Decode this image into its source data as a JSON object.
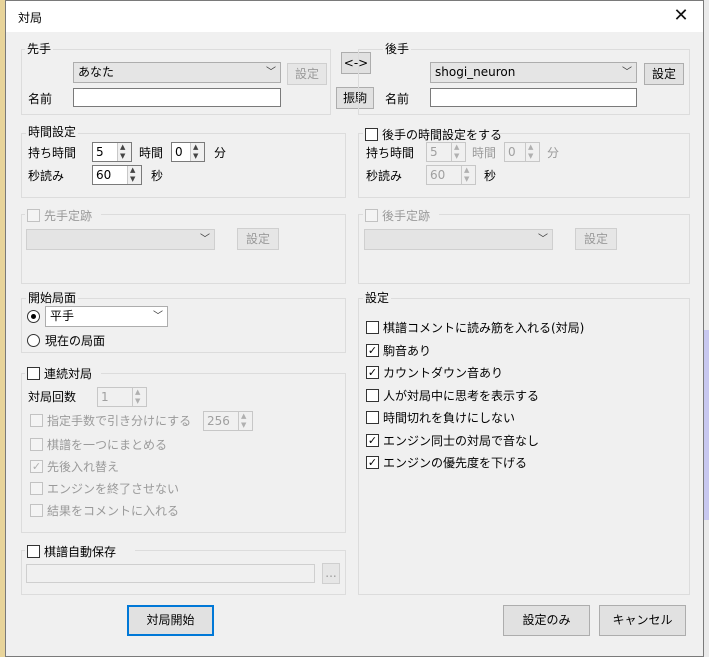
{
  "window": {
    "title": "対局",
    "close_glyph": "✕"
  },
  "sente": {
    "group_label": "先手",
    "player": "あなた",
    "settings_button": "設定",
    "name_label": "名前",
    "name_value": ""
  },
  "swap_button": "<->",
  "furigoma_button": "振駒",
  "gote": {
    "group_label": "後手",
    "player": "shogi_neuron",
    "settings_button": "設定",
    "name_label": "名前",
    "name_value": ""
  },
  "time_settings": {
    "group_label": "時間設定",
    "mochi_label": "持ち時間",
    "hours_value": "5",
    "hours_unit": "時間",
    "minutes_value": "0",
    "minutes_unit": "分",
    "byoyomi_label": "秒読み",
    "byoyomi_value": "60",
    "byoyomi_unit": "秒"
  },
  "gote_time": {
    "checkbox_label": "後手の時間設定をする",
    "mochi_label": "持ち時間",
    "hours_value": "5",
    "hours_unit": "時間",
    "minutes_value": "0",
    "minutes_unit": "分",
    "byoyomi_label": "秒読み",
    "byoyomi_value": "60",
    "byoyomi_unit": "秒"
  },
  "sente_joseki": {
    "checkbox_label": "先手定跡",
    "settings_button": "設定"
  },
  "gote_joseki": {
    "checkbox_label": "後手定跡",
    "settings_button": "設定"
  },
  "start_position": {
    "group_label": "開始局面",
    "preset_radio_selected": true,
    "preset_value": "平手",
    "current_label": "現在の局面"
  },
  "continuous": {
    "checkbox_label": "連続対局",
    "count_label": "対局回数",
    "count_value": "1",
    "draw_label": "指定手数で引き分けにする",
    "draw_value": "256",
    "merge_label": "棋譜を一つにまとめる",
    "swap_label": "先後入れ替え",
    "swap_checked": true,
    "no_quit_label": "エンジンを終了させない",
    "comment_label": "結果をコメントに入れる"
  },
  "autosave": {
    "checkbox_label": "棋譜自動保存",
    "browse_button": "..."
  },
  "settings": {
    "group_label": "設定",
    "options": [
      {
        "label": "棋譜コメントに読み筋を入れる(対局)",
        "checked": false
      },
      {
        "label": "駒音あり",
        "checked": true
      },
      {
        "label": "カウントダウン音あり",
        "checked": true
      },
      {
        "label": "人が対局中に思考を表示する",
        "checked": false
      },
      {
        "label": "時間切れを負けにしない",
        "checked": false
      },
      {
        "label": "エンジン同士の対局で音なし",
        "checked": true
      },
      {
        "label": "エンジンの優先度を下げる",
        "checked": true
      }
    ]
  },
  "buttons": {
    "start": "対局開始",
    "settings_only": "設定のみ",
    "cancel": "キャンセル"
  },
  "check_glyph": "✓"
}
